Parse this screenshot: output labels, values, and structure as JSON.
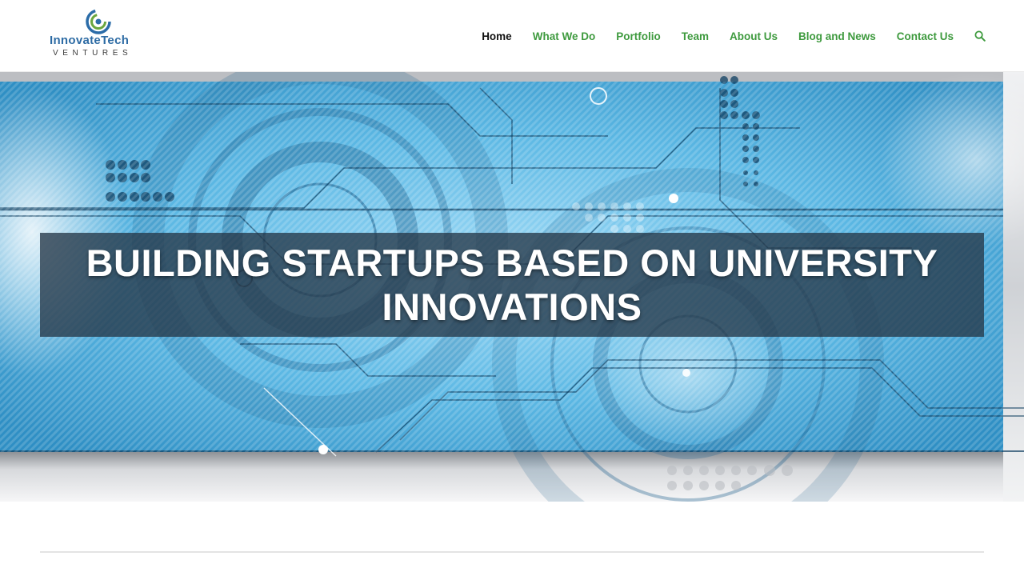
{
  "logo": {
    "word_part1": "InnovateTech",
    "word_part2": "",
    "subtitle": "VENTURES"
  },
  "nav": {
    "items": [
      {
        "label": "Home",
        "active": true
      },
      {
        "label": "What We Do",
        "active": false
      },
      {
        "label": "Portfolio",
        "active": false
      },
      {
        "label": "Team",
        "active": false
      },
      {
        "label": "About Us",
        "active": false
      },
      {
        "label": "Blog and News",
        "active": false
      },
      {
        "label": "Contact Us",
        "active": false
      }
    ],
    "search_icon": "search-icon"
  },
  "hero": {
    "title_line1": "BUILDING STARTUPS BASED ON UNIVERSITY",
    "title_line2": "INNOVATIONS"
  },
  "colors": {
    "accent_green": "#3e9a3e",
    "active_nav": "#111111",
    "hero_blue": "#5ab8e6",
    "hero_overlay": "#253748"
  }
}
